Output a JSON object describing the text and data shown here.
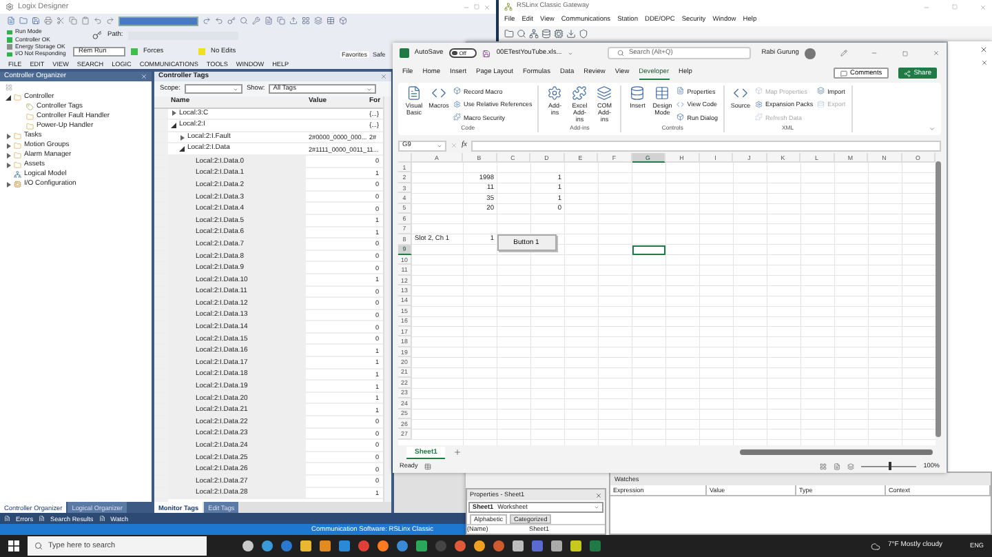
{
  "logix": {
    "title": "Logix Designer",
    "status_lines": [
      {
        "label": "Run Mode",
        "color": "#2fb34a"
      },
      {
        "label": "Controller OK",
        "color": "#2fb34a"
      },
      {
        "label": "Energy Storage OK",
        "color": "#8a8f8a"
      },
      {
        "label": "I/O Not Responding",
        "color": "#2fb34a"
      }
    ],
    "path_label": "Path:",
    "mode": "Rem Run",
    "forces": "Forces",
    "edits": "No Edits",
    "palette_tabs": [
      {
        "label": "Favorites",
        "selected": true
      },
      {
        "label": "Safe",
        "selected": false
      }
    ],
    "menu": [
      "FILE",
      "EDIT",
      "VIEW",
      "SEARCH",
      "LOGIC",
      "COMMUNICATIONS",
      "TOOLS",
      "WINDOW",
      "HELP"
    ],
    "organizer": {
      "title": "Controller Organizer",
      "tree": [
        {
          "label": "Controller",
          "kind": "folder",
          "expanded": true,
          "children": [
            {
              "label": "Controller Tags",
              "kind": "tags"
            },
            {
              "label": "Controller Fault Handler",
              "kind": "folder"
            },
            {
              "label": "Power-Up Handler",
              "kind": "folder"
            }
          ]
        },
        {
          "label": "Tasks",
          "kind": "folder",
          "expanded": false
        },
        {
          "label": "Motion Groups",
          "kind": "folder",
          "expanded": false
        },
        {
          "label": "Alarm Manager",
          "kind": "folder",
          "expanded": false
        },
        {
          "label": "Assets",
          "kind": "folder",
          "expanded": false
        },
        {
          "label": "Logical Model",
          "kind": "model"
        },
        {
          "label": "I/O Configuration",
          "kind": "io",
          "expanded": false
        }
      ],
      "tabs": [
        {
          "label": "Controller Organizer",
          "selected": true
        },
        {
          "label": "Logical Organizer",
          "selected": false
        }
      ]
    },
    "tags": {
      "title": "Controller Tags",
      "scope_label": "Scope:",
      "show_label": "Show:",
      "show_value": "All Tags",
      "columns": [
        "Name",
        "Value",
        "For"
      ],
      "rows": [
        {
          "name": "Local:3:C",
          "value": "{...}",
          "expanded": false
        },
        {
          "name": "Local:2:I",
          "value": "{...}",
          "expanded": true,
          "children": [
            {
              "name": "Local:2:I.Fault",
              "value": "2#0000_0000_000...",
              "force": "2#",
              "expanded": false
            },
            {
              "name": "Local:2:I.Data",
              "value": "2#1111_0000_0011_11...",
              "expanded": true,
              "children": [
                {
                  "name": "Local:2:I.Data.0",
                  "value": "0"
                },
                {
                  "name": "Local:2:I.Data.1",
                  "value": "1"
                },
                {
                  "name": "Local:2:I.Data.2",
                  "value": "0"
                },
                {
                  "name": "Local:2:I.Data.3",
                  "value": "0"
                },
                {
                  "name": "Local:2:I.Data.4",
                  "value": "0"
                },
                {
                  "name": "Local:2:I.Data.5",
                  "value": "1"
                },
                {
                  "name": "Local:2:I.Data.6",
                  "value": "1"
                },
                {
                  "name": "Local:2:I.Data.7",
                  "value": "0"
                },
                {
                  "name": "Local:2:I.Data.8",
                  "value": "0"
                },
                {
                  "name": "Local:2:I.Data.9",
                  "value": "0"
                },
                {
                  "name": "Local:2:I.Data.10",
                  "value": "1"
                },
                {
                  "name": "Local:2:I.Data.11",
                  "value": "0"
                },
                {
                  "name": "Local:2:I.Data.12",
                  "value": "0"
                },
                {
                  "name": "Local:2:I.Data.13",
                  "value": "0"
                },
                {
                  "name": "Local:2:I.Data.14",
                  "value": "0"
                },
                {
                  "name": "Local:2:I.Data.15",
                  "value": "0"
                },
                {
                  "name": "Local:2:I.Data.16",
                  "value": "1"
                },
                {
                  "name": "Local:2:I.Data.17",
                  "value": "1"
                },
                {
                  "name": "Local:2:I.Data.18",
                  "value": "1"
                },
                {
                  "name": "Local:2:I.Data.19",
                  "value": "1"
                },
                {
                  "name": "Local:2:I.Data.20",
                  "value": "1"
                },
                {
                  "name": "Local:2:I.Data.21",
                  "value": "1"
                },
                {
                  "name": "Local:2:I.Data.22",
                  "value": "0"
                },
                {
                  "name": "Local:2:I.Data.23",
                  "value": "0"
                },
                {
                  "name": "Local:2:I.Data.24",
                  "value": "0"
                },
                {
                  "name": "Local:2:I.Data.25",
                  "value": "0"
                },
                {
                  "name": "Local:2:I.Data.26",
                  "value": "0"
                },
                {
                  "name": "Local:2:I.Data.27",
                  "value": "0"
                },
                {
                  "name": "Local:2:I.Data.28",
                  "value": "1"
                }
              ]
            }
          ]
        }
      ],
      "tabs": [
        {
          "label": "Monitor Tags",
          "selected": true
        },
        {
          "label": "Edit Tags",
          "selected": false
        }
      ]
    },
    "output_tabs": [
      "Errors",
      "Search Results",
      "Watch"
    ],
    "status_bar": "Communication Software: RSLinx Classic"
  },
  "rslinx": {
    "title": "RSLinx Classic Gateway",
    "menu": [
      "File",
      "Edit",
      "View",
      "Communications",
      "Station",
      "DDE/OPC",
      "Security",
      "Window",
      "Help"
    ]
  },
  "excel": {
    "autosave_label": "AutoSave",
    "autosave": {
      "on": false,
      "label": "Off"
    },
    "filename": "00ETestYouTube.xls...",
    "search_placeholder": "Search (Alt+Q)",
    "user": "Rabi Gurung",
    "tabs": [
      {
        "label": "File",
        "selected": false
      },
      {
        "label": "Home",
        "selected": false
      },
      {
        "label": "Insert",
        "selected": false
      },
      {
        "label": "Page Layout",
        "selected": false
      },
      {
        "label": "Formulas",
        "selected": false
      },
      {
        "label": "Data",
        "selected": false
      },
      {
        "label": "Review",
        "selected": false
      },
      {
        "label": "View",
        "selected": false
      },
      {
        "label": "Developer",
        "selected": true
      },
      {
        "label": "Help",
        "selected": false
      }
    ],
    "comments": "Comments",
    "share": "Share",
    "ribbon": [
      {
        "label": "Code",
        "items": [
          {
            "kind": "large",
            "label": "Visual Basic",
            "disabled": false
          },
          {
            "kind": "large",
            "label": "Macros",
            "disabled": false
          },
          {
            "kind": "small",
            "label": "Record Macro",
            "disabled": false
          },
          {
            "kind": "small",
            "label": "Use Relative References",
            "disabled": false
          },
          {
            "kind": "small",
            "label": "Macro Security",
            "disabled": false
          }
        ]
      },
      {
        "label": "Add-ins",
        "items": [
          {
            "kind": "large",
            "label": "Add-ins",
            "disabled": false
          },
          {
            "kind": "large",
            "label": "Excel Add-ins",
            "disabled": false
          },
          {
            "kind": "large",
            "label": "COM Add-ins",
            "disabled": false
          }
        ]
      },
      {
        "label": "Controls",
        "items": [
          {
            "kind": "large",
            "label": "Insert",
            "disabled": false
          },
          {
            "kind": "large",
            "label": "Design Mode",
            "disabled": false
          },
          {
            "kind": "small",
            "label": "Properties",
            "disabled": false
          },
          {
            "kind": "small",
            "label": "View Code",
            "disabled": false
          },
          {
            "kind": "small",
            "label": "Run Dialog",
            "disabled": false
          }
        ]
      },
      {
        "label": "XML",
        "items": [
          {
            "kind": "large",
            "label": "Source",
            "disabled": false
          },
          {
            "kind": "small",
            "label": "Map Properties",
            "disabled": true
          },
          {
            "kind": "small",
            "label": "Expansion Packs",
            "disabled": false
          },
          {
            "kind": "small",
            "label": "Refresh Data",
            "disabled": true
          },
          {
            "kind": "small",
            "label": "Import",
            "disabled": false
          },
          {
            "kind": "small",
            "label": "Export",
            "disabled": true
          }
        ]
      }
    ],
    "name_box": "G9",
    "function_label": "fx",
    "columns": [
      {
        "label": "A",
        "selected": false
      },
      {
        "label": "B",
        "selected": false
      },
      {
        "label": "C",
        "selected": false
      },
      {
        "label": "D",
        "selected": false
      },
      {
        "label": "E",
        "selected": false
      },
      {
        "label": "F",
        "selected": false
      },
      {
        "label": "G",
        "selected": true
      },
      {
        "label": "H",
        "selected": false
      },
      {
        "label": "I",
        "selected": false
      },
      {
        "label": "J",
        "selected": false
      },
      {
        "label": "K",
        "selected": false
      },
      {
        "label": "L",
        "selected": false
      },
      {
        "label": "M",
        "selected": false
      },
      {
        "label": "N",
        "selected": false
      },
      {
        "label": "O",
        "selected": false
      }
    ],
    "rows": [
      {
        "label": "1",
        "selected": false,
        "cells": []
      },
      {
        "label": "2",
        "selected": false,
        "cells": [
          null,
          "1998",
          null,
          "1"
        ]
      },
      {
        "label": "3",
        "selected": false,
        "cells": [
          null,
          "11",
          null,
          "1"
        ]
      },
      {
        "label": "4",
        "selected": false,
        "cells": [
          null,
          "35",
          null,
          "1"
        ]
      },
      {
        "label": "5",
        "selected": false,
        "cells": [
          null,
          "20",
          null,
          "0"
        ]
      },
      {
        "label": "6",
        "selected": false,
        "cells": []
      },
      {
        "label": "7",
        "selected": false,
        "cells": []
      },
      {
        "label": "8",
        "selected": false,
        "cells": [
          "Slot 2, Ch 1",
          "1"
        ]
      },
      {
        "label": "9",
        "selected": true,
        "cells": []
      },
      {
        "label": "10",
        "selected": false,
        "cells": []
      },
      {
        "label": "11",
        "selected": false,
        "cells": []
      },
      {
        "label": "12",
        "selected": false,
        "cells": []
      },
      {
        "label": "13",
        "selected": false,
        "cells": []
      },
      {
        "label": "14",
        "selected": false,
        "cells": []
      },
      {
        "label": "15",
        "selected": false,
        "cells": []
      },
      {
        "label": "16",
        "selected": false,
        "cells": []
      },
      {
        "label": "17",
        "selected": false,
        "cells": []
      },
      {
        "label": "18",
        "selected": false,
        "cells": []
      },
      {
        "label": "19",
        "selected": false,
        "cells": []
      },
      {
        "label": "20",
        "selected": false,
        "cells": []
      },
      {
        "label": "21",
        "selected": false,
        "cells": []
      },
      {
        "label": "22",
        "selected": false,
        "cells": []
      },
      {
        "label": "23",
        "selected": false,
        "cells": []
      },
      {
        "label": "24",
        "selected": false,
        "cells": []
      },
      {
        "label": "25",
        "selected": false,
        "cells": []
      },
      {
        "label": "26",
        "selected": false,
        "cells": []
      },
      {
        "label": "27",
        "selected": false,
        "cells": []
      }
    ],
    "sheet_button": "Button 1",
    "sheets": [
      {
        "label": "Sheet1",
        "selected": true
      }
    ],
    "status": "Ready",
    "zoom": {
      "level": 0.5,
      "reading": "100%"
    }
  },
  "vba": {
    "properties": {
      "title": "Properties - Sheet1",
      "object": "Sheet1",
      "object_type": "Worksheet",
      "tabs": [
        {
          "label": "Alphabetic",
          "selected": true
        },
        {
          "label": "Categorized",
          "selected": false
        }
      ],
      "row": [
        "(Name)",
        "Sheet1"
      ]
    },
    "watches": {
      "title": "Watches",
      "columns": [
        "Expression",
        "Value",
        "Type",
        "Context"
      ]
    }
  },
  "taskbar": {
    "search_placeholder": "Type here to search",
    "weather": "7°F  Mostly cloudy",
    "language": "ENG"
  }
}
